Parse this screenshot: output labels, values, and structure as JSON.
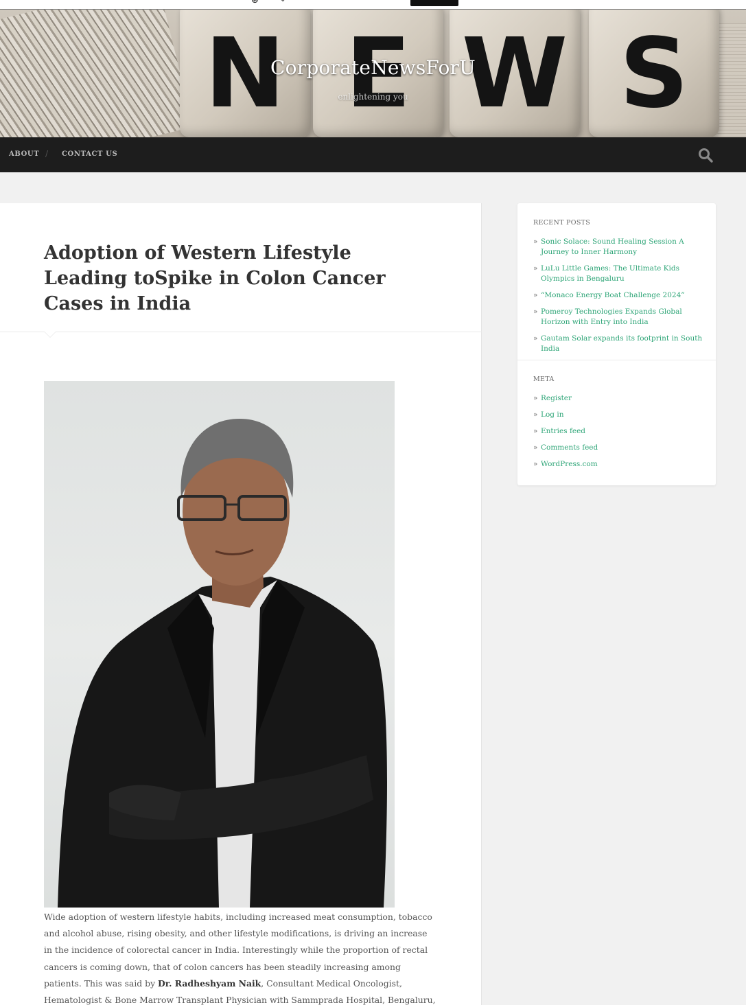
{
  "site": {
    "title": "CorporateNewsForU",
    "description": "enlightening you",
    "banner_letters": [
      "N",
      "E",
      "W",
      "S"
    ]
  },
  "nav": {
    "items": [
      {
        "label": "About"
      },
      {
        "label": "Contact Us"
      }
    ],
    "separator": "/",
    "search_icon": "search-icon"
  },
  "post": {
    "title": "Adoption of Western Lifestyle Leading toSpike in Colon Cancer Cases in India",
    "body_intro": "Wide adoption of western lifestyle habits, including increased meat consumption, tobacco and alcohol abuse, rising obesity, and other lifestyle modifications, is driving an increase in the incidence of colorectal cancer in India. Interestingly while the proportion of rectal cancers is coming down, that of colon cancers has been steadily increasing among patients. This was said by ",
    "body_bold": "Dr. Radheshyam Naik",
    "body_rest": ", Consultant Medical Oncologist, Hematologist & Bone Marrow Transplant Physician with Sammprada Hospital, Bengaluru, during the ongoing Colorectal Cancer Awareness Month."
  },
  "sidebar": {
    "recent_posts": {
      "title": "Recent Posts",
      "items": [
        "Sonic Solace: Sound Healing Session A Journey to Inner Harmony",
        "LuLu Little Games: The Ultimate Kids Olympics in Bengaluru",
        "“Monaco Energy Boat Challenge 2024”",
        "Pomeroy Technologies Expands Global Horizon with Entry into India",
        "Gautam Solar expands its footprint in South India"
      ]
    },
    "meta": {
      "title": "Meta",
      "items": [
        "Register",
        "Log in",
        "Entries feed",
        "Comments feed",
        "WordPress.com"
      ]
    }
  },
  "colors": {
    "nav_bg": "#1d1d1d",
    "link": "#2ea577",
    "page_bg": "#f1f1f1"
  }
}
